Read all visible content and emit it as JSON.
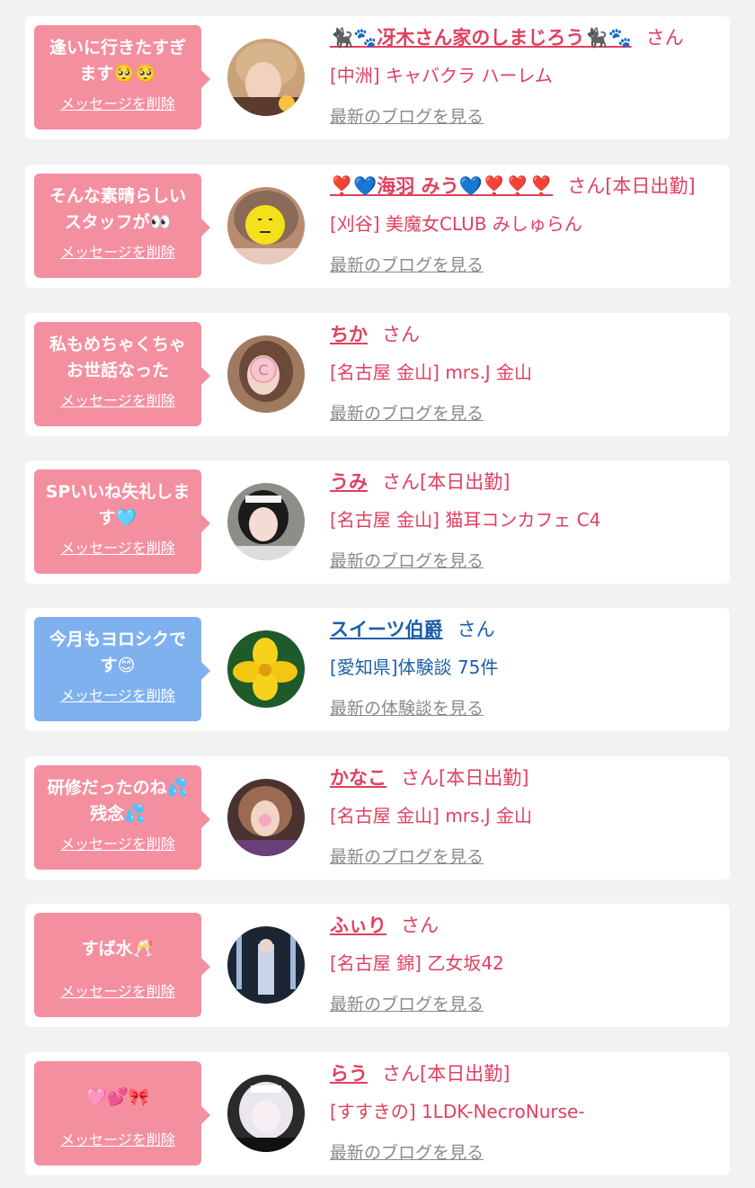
{
  "delete_label": "メッセージを削除",
  "items": [
    {
      "message": "逢いに行きたすぎ\nます🥺🥺",
      "name": "🐈‍⬛🐾冴木さん家のしまじろう🐈‍⬛🐾",
      "suffix": "さん",
      "shop": "[中洲] キャバクラ ハーレム",
      "link": "最新のブログを見る"
    },
    {
      "message": "そんな素晴らしい\nスタッフが👀",
      "name": "❣️💙海羽 みう💙❣️❣️❣️",
      "suffix": "さん[本日出勤]",
      "shop": "[刈谷] 美魔女CLUB みしゅらん",
      "link": "最新のブログを見る"
    },
    {
      "message": "私もめちゃくちゃ\nお世話なった",
      "name": "ちか",
      "suffix": "さん",
      "shop": "[名古屋 金山] mrs.J 金山",
      "link": "最新のブログを見る"
    },
    {
      "message": "SPいいね失礼しま\nす🩵",
      "name": "うみ",
      "suffix": "さん[本日出勤]",
      "shop": "[名古屋 金山] 猫耳コンカフェ C4",
      "link": "最新のブログを見る"
    },
    {
      "message": "今月もヨロシクで\nす😊",
      "name": "スイーツ伯爵",
      "suffix": "さん",
      "shop": "[愛知県]体験談 75件",
      "link": "最新の体験談を見る"
    },
    {
      "message": "研修だったのね💦\n残念💦",
      "name": "かなこ",
      "suffix": "さん[本日出勤]",
      "shop": "[名古屋 金山] mrs.J 金山",
      "link": "最新のブログを見る"
    },
    {
      "message": "すば水🥂",
      "name": "ふぃり",
      "suffix": "さん",
      "shop": "[名古屋 錦] 乙女坂42",
      "link": "最新のブログを見る"
    },
    {
      "message": "🩷💕🎀",
      "name": "らう",
      "suffix": "さん[本日出勤]",
      "shop": "[すすきの] 1LDK-NecroNurse-",
      "link": "最新のブログを見る"
    }
  ]
}
